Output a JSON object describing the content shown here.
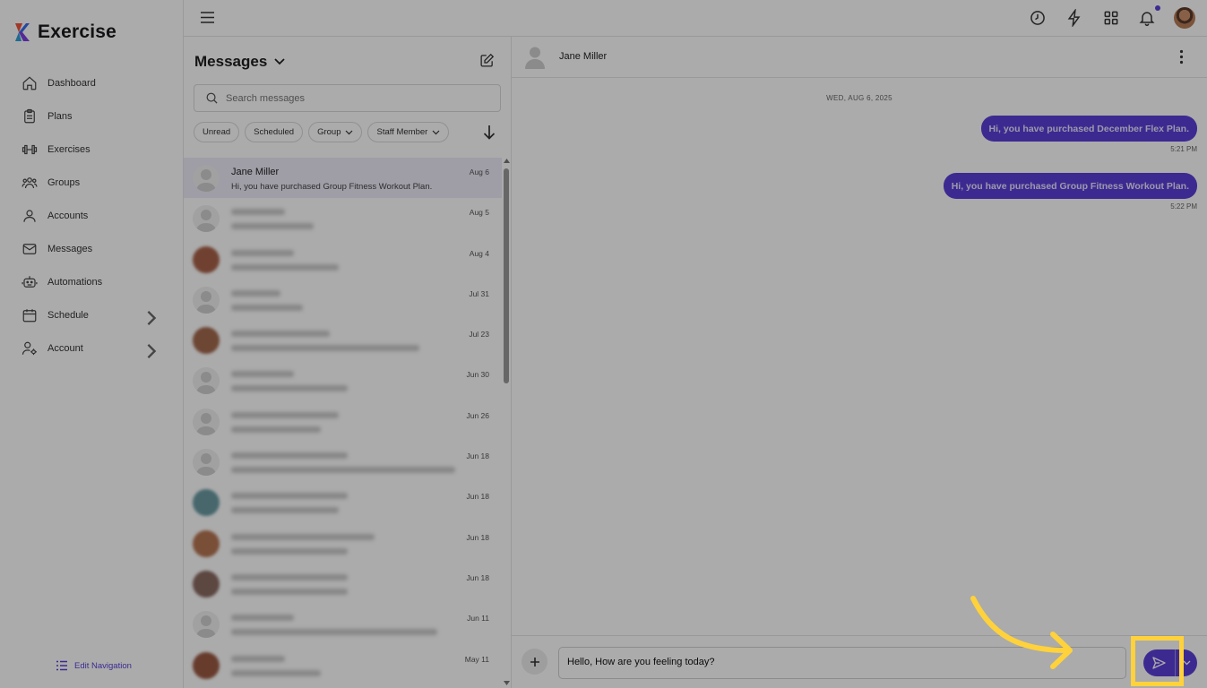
{
  "app": {
    "name": "Exercise",
    "accent": "#5b3fd8"
  },
  "sidebar": {
    "items": [
      {
        "label": "Dashboard",
        "icon": "home-icon"
      },
      {
        "label": "Plans",
        "icon": "clipboard-icon"
      },
      {
        "label": "Exercises",
        "icon": "dumbbell-icon"
      },
      {
        "label": "Groups",
        "icon": "users-icon"
      },
      {
        "label": "Accounts",
        "icon": "user-icon"
      },
      {
        "label": "Messages",
        "icon": "mail-icon"
      },
      {
        "label": "Automations",
        "icon": "robot-icon"
      },
      {
        "label": "Schedule",
        "icon": "calendar-icon",
        "has_submenu": true
      },
      {
        "label": "Account",
        "icon": "user-gear-icon",
        "has_submenu": true
      }
    ],
    "edit_navigation": "Edit Navigation"
  },
  "topbar": {
    "icons": [
      "menu-icon",
      "history-icon",
      "lightning-icon",
      "apps-grid-icon",
      "bell-icon",
      "profile-avatar"
    ]
  },
  "messages": {
    "title": "Messages",
    "search_placeholder": "Search messages",
    "filters": [
      {
        "label": "Unread",
        "dropdown": false
      },
      {
        "label": "Scheduled",
        "dropdown": false
      },
      {
        "label": "Group",
        "dropdown": true
      },
      {
        "label": "Staff Member",
        "dropdown": true
      }
    ],
    "conversations": [
      {
        "name": "Jane Miller",
        "preview": "Hi, you have purchased Group Fitness Workout Plan.",
        "date": "Aug 6",
        "active": true
      },
      {
        "name": "",
        "preview": "",
        "date": "Aug 5",
        "blurred": true
      },
      {
        "name": "",
        "preview": "",
        "date": "Aug 4",
        "blurred": true,
        "photo": true
      },
      {
        "name": "",
        "preview": "",
        "date": "Jul 31",
        "blurred": true
      },
      {
        "name": "",
        "preview": "",
        "date": "Jul 23",
        "blurred": true,
        "photo": true
      },
      {
        "name": "",
        "preview": "",
        "date": "Jun 30",
        "blurred": true
      },
      {
        "name": "",
        "preview": "",
        "date": "Jun 26",
        "blurred": true
      },
      {
        "name": "",
        "preview": "",
        "date": "Jun 18",
        "blurred": true
      },
      {
        "name": "",
        "preview": "",
        "date": "Jun 18",
        "blurred": true,
        "photo": true
      },
      {
        "name": "",
        "preview": "",
        "date": "Jun 18",
        "blurred": true,
        "photo": true
      },
      {
        "name": "",
        "preview": "",
        "date": "Jun 18",
        "blurred": true,
        "photo": true
      },
      {
        "name": "",
        "preview": "",
        "date": "Jun 11",
        "blurred": true
      },
      {
        "name": "",
        "preview": "",
        "date": "May 11",
        "blurred": true,
        "photo": true
      }
    ]
  },
  "chat": {
    "contact_name": "Jane Miller",
    "date_separator": "WED, AUG 6, 2025",
    "messages": [
      {
        "text": "Hi, you have purchased December Flex Plan.",
        "time": "5:21 PM"
      },
      {
        "text": "Hi, you have purchased Group Fitness Workout Plan.",
        "time": "5:22 PM"
      }
    ],
    "composer_value": "Hello, How are you feeling today?"
  }
}
